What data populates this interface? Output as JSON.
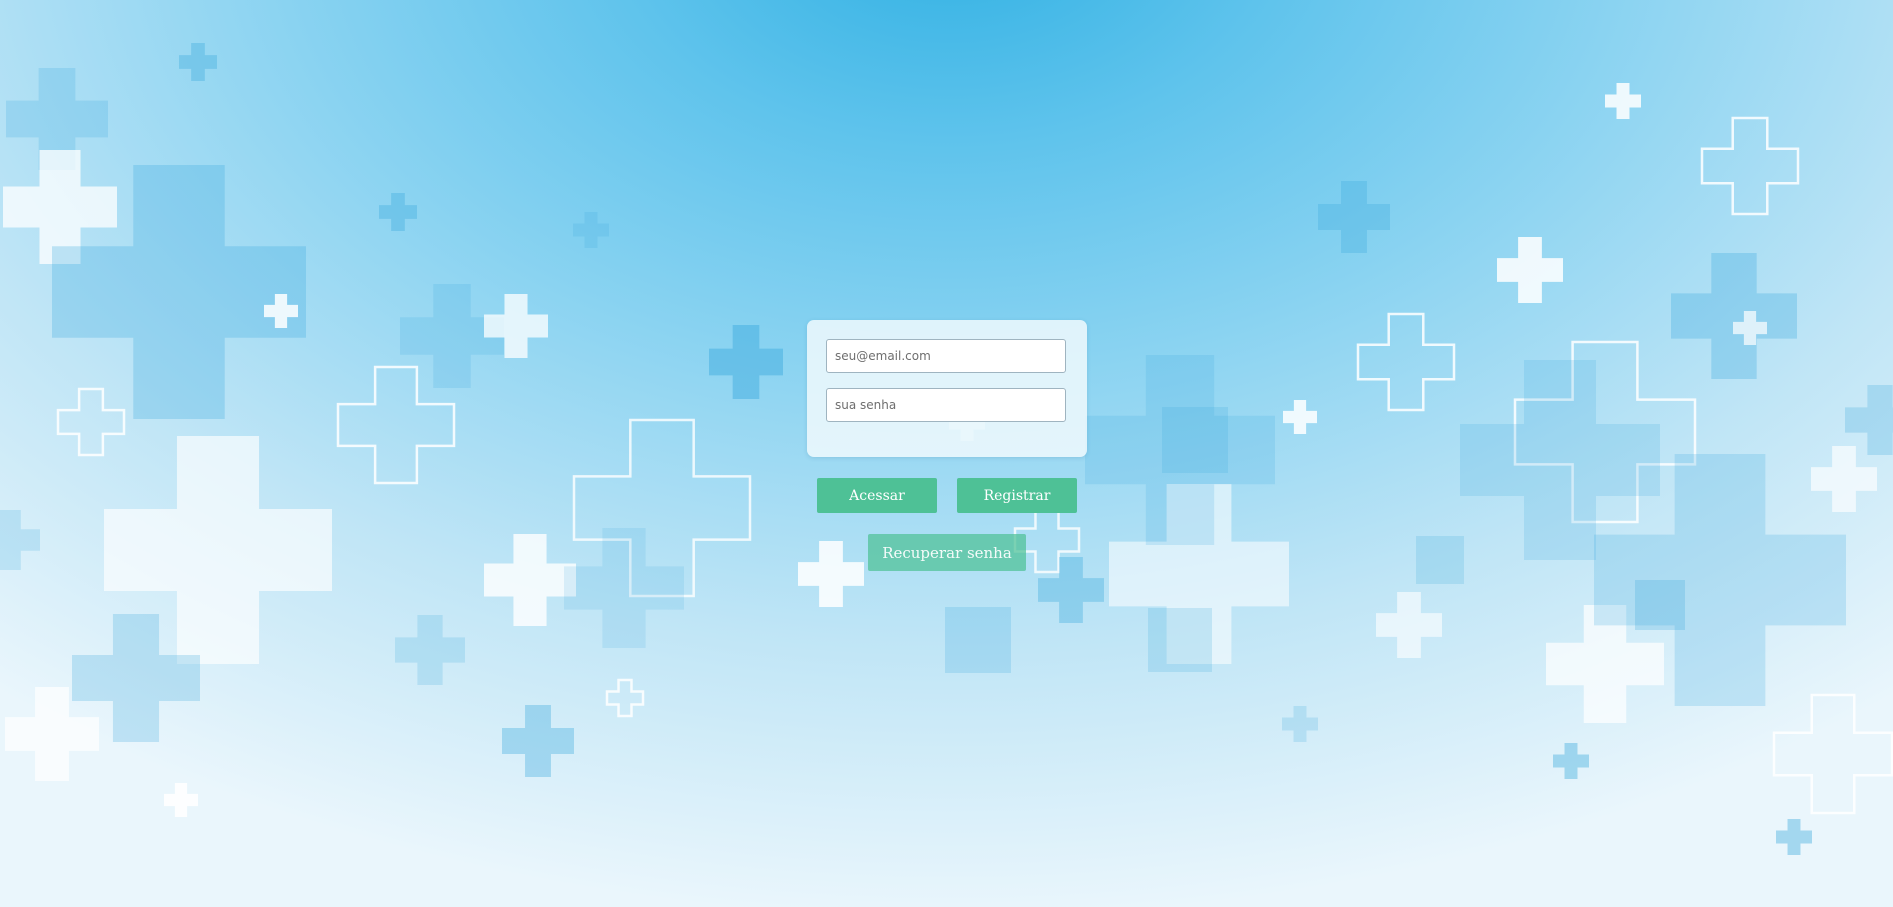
{
  "login": {
    "email_placeholder": "seu@email.com",
    "password_placeholder": "sua senha",
    "access_label": "Acessar",
    "register_label": "Registrar",
    "recover_label": "Recuperar senha"
  },
  "colors": {
    "button": "#4ec196",
    "background_center": "#2fb0e3",
    "background_edge": "#eaf6fc"
  },
  "background": {
    "pattern_icon": "medical-cross-icon"
  }
}
